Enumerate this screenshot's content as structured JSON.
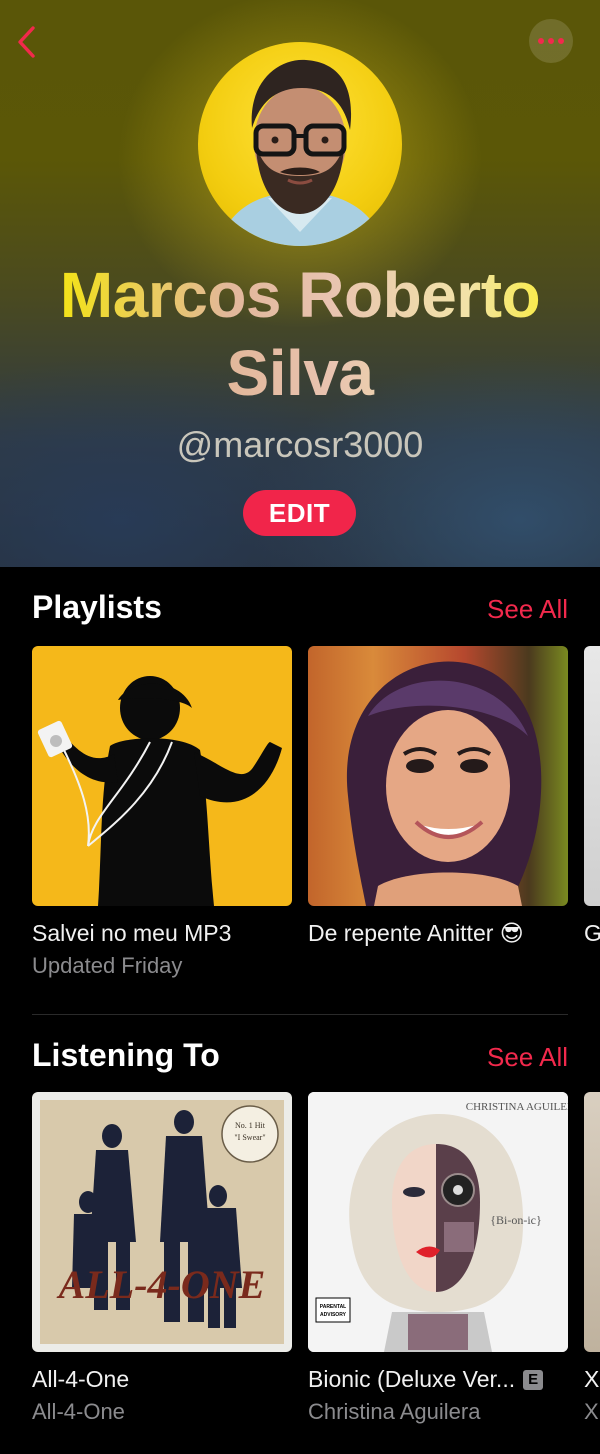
{
  "profile": {
    "name": "Marcos Roberto Silva",
    "handle": "@marcosr3000",
    "edit_label": "EDIT"
  },
  "icons": {
    "back": "chevron-left-icon",
    "more": "ellipsis-icon"
  },
  "colors": {
    "accent": "#f2294c",
    "edit_button": "#f1254a",
    "secondary_text": "#8b8b8e"
  },
  "playlists": {
    "title": "Playlists",
    "see_all": "See All",
    "items": [
      {
        "title": "Salvei no meu MP3",
        "subtitle": "Updated Friday"
      },
      {
        "title": "De repente Anitter 😎",
        "subtitle": ""
      },
      {
        "title": "G",
        "subtitle": ""
      }
    ]
  },
  "listening": {
    "title": "Listening To",
    "see_all": "See All",
    "items": [
      {
        "title": "All-4-One",
        "subtitle": "All-4-One",
        "cover_text": "ALL-4-ONE",
        "sticker_text": "No. 1 Hit \"I Swear\"",
        "explicit": false
      },
      {
        "title": "Bionic (Deluxe Ver...",
        "subtitle": "Christina Aguilera",
        "cover_artist": "CHRISTINA AGUILERA",
        "cover_text": "{Bi-on-ic}",
        "explicit": true,
        "explicit_label": "E",
        "advisory": "PARENTAL ADVISORY"
      },
      {
        "title": "X",
        "subtitle": "X"
      }
    ]
  }
}
